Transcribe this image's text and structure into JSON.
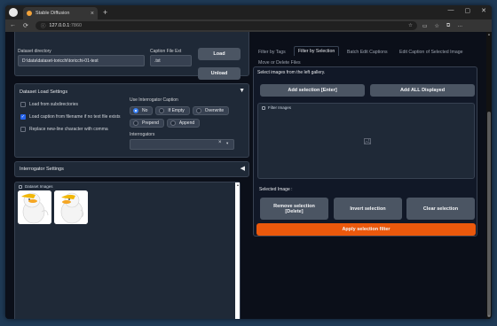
{
  "browser": {
    "tab_title": "Stable Diffusion",
    "url_host": "127.0.0.1",
    "url_port": ":7860",
    "new_tab_symbol": "+",
    "tab_close_symbol": "×",
    "window_controls": [
      "—",
      "▢",
      "✕"
    ],
    "nav_symbols": [
      "←",
      "⟳"
    ]
  },
  "dataset": {
    "directory_label": "Dataset directory",
    "directory_value": "D:\\data\\dataset-toricchi\\toricchi-01-test",
    "caption_ext_label": "Caption File Ext",
    "caption_ext_value": ".txt",
    "load_button": "Load",
    "unload_button": "Unload"
  },
  "load_settings": {
    "title": "Dataset Load Settings",
    "checkboxes": [
      {
        "label": "Load from subdirectories",
        "checked": false
      },
      {
        "label": "Load caption from filename if no text file exists",
        "checked": true
      },
      {
        "label": "Replace new-line character with comma",
        "checked": false
      }
    ],
    "interrogator_caption_label": "Use Interrogator Caption",
    "caption_modes": [
      {
        "label": "No",
        "selected": true
      },
      {
        "label": "If Empty",
        "selected": false
      },
      {
        "label": "Overwrite",
        "selected": false
      },
      {
        "label": "Prepend",
        "selected": false
      },
      {
        "label": "Append",
        "selected": false
      }
    ],
    "interrogators_label": "Interrogators",
    "interrogators_value": ""
  },
  "interrogator_settings": {
    "title": "Interrogator Settings"
  },
  "gallery": {
    "label": "Dataset Images",
    "image_count": 2
  },
  "right_panel": {
    "tabs": [
      {
        "label": "Filter by Tags",
        "active": false
      },
      {
        "label": "Filter by Selection",
        "active": true
      },
      {
        "label": "Batch Edit Captions",
        "active": false
      },
      {
        "label": "Edit Caption of Selected Image",
        "active": false
      },
      {
        "label": "Move or Delete Files",
        "active": false
      }
    ],
    "instruction": "Select images from the left gallery.",
    "add_selection_button": "Add selection [Enter]",
    "add_all_button": "Add ALL Displayed",
    "filter_images_label": "Filter Images",
    "selected_image_label": "Selected Image :",
    "remove_selection_button_line1": "Remove selection",
    "remove_selection_button_line2": "[Delete]",
    "invert_selection_button": "Invert selection",
    "clear_selection_button": "Clear selection",
    "apply_filter_button": "Apply selection filter"
  },
  "colors": {
    "accent": "#ea580c",
    "panel": "#1f2937",
    "background": "#0b0f19",
    "checkbox_on": "#2563eb"
  }
}
